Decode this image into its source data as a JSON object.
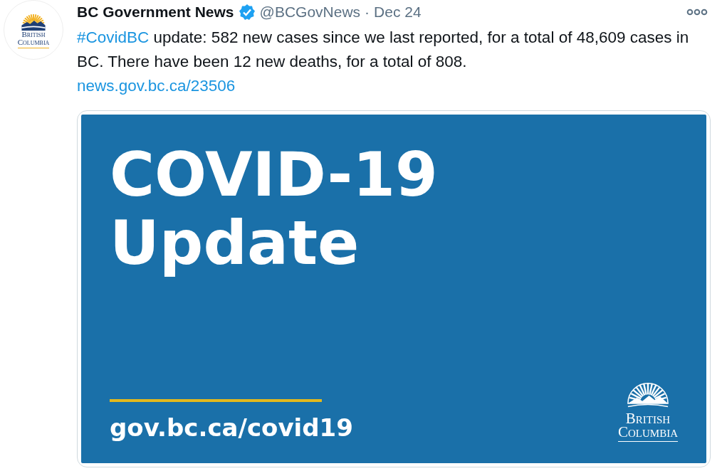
{
  "tweet": {
    "avatar": {
      "logo_lines": [
        "British",
        "Columbia"
      ]
    },
    "author": {
      "name": "BC Government News",
      "verified": true,
      "handle": "@BCGovNews",
      "separator": "·",
      "date": "Dec 24"
    },
    "text": [
      {
        "kind": "hashtag",
        "text": "#CovidBC"
      },
      {
        "kind": "plain",
        "text": " update: 582 new cases since we last reported, for a total of 48,609 cases in BC. There have been 12 new deaths, for a total of 808."
      }
    ],
    "link": "news.gov.bc.ca/23506",
    "media": {
      "title_lines": [
        "COVID-19",
        "Update"
      ],
      "url": "gov.bc.ca/covid19",
      "logo_lines": [
        "British",
        "Columbia"
      ]
    }
  }
}
